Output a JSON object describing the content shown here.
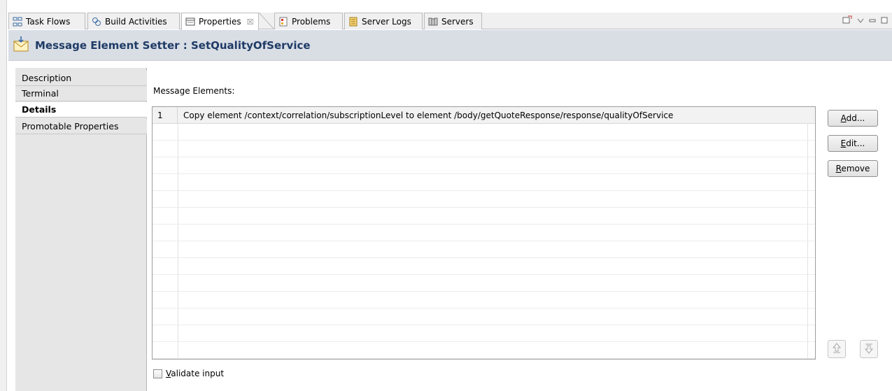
{
  "tabs": [
    {
      "label": "Task Flows",
      "icon": "task-flows-icon"
    },
    {
      "label": "Build Activities",
      "icon": "build-activities-icon"
    },
    {
      "label": "Properties",
      "icon": "properties-icon",
      "active": true,
      "close": "☒"
    },
    {
      "label": "Problems",
      "icon": "problems-icon"
    },
    {
      "label": "Server Logs",
      "icon": "server-logs-icon"
    },
    {
      "label": "Servers",
      "icon": "servers-icon"
    }
  ],
  "view_tools": [
    "new-view-icon",
    "view-menu-icon",
    "minimize-icon",
    "maximize-icon"
  ],
  "header": {
    "title": "Message Element Setter : SetQualityOfService",
    "icon": "message-envelope-icon"
  },
  "categories": [
    {
      "label": "Description",
      "selected": false
    },
    {
      "label": "Terminal",
      "selected": false
    },
    {
      "label": "Details",
      "selected": true
    },
    {
      "label": "Promotable Properties",
      "selected": false
    }
  ],
  "main": {
    "message_elements_label": "Message Elements:",
    "rows": [
      {
        "num": "1",
        "text": "Copy element /context/correlation/subscriptionLevel to element /body/getQuoteResponse/response/qualityOfService"
      }
    ],
    "buttons": {
      "add_mnemonic": "A",
      "add_rest": "dd...",
      "edit_mnemonic": "E",
      "edit_rest": "dit...",
      "remove_mnemonic": "R",
      "remove_rest": "emove"
    },
    "validate_mnemonic": "V",
    "validate_rest": "alidate input",
    "validate_checked": false
  },
  "colors": {
    "header_bg": "#d9dee5",
    "header_text": "#1f3b66",
    "category_bg": "#e6e6e6"
  }
}
